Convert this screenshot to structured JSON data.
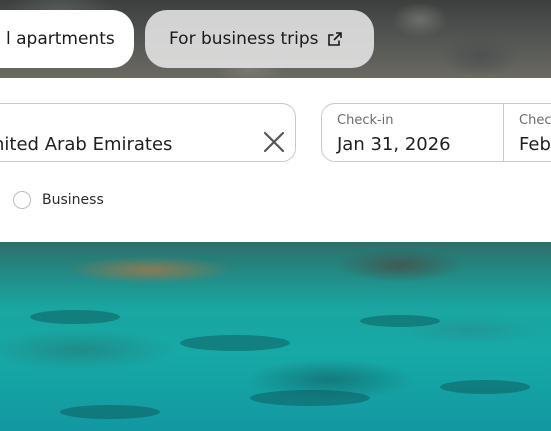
{
  "tabs": {
    "apartments_label": "l apartments",
    "business_label": "For business trips",
    "business_icon": "external-link-icon"
  },
  "search": {
    "destination_value": "nited Arab Emirates",
    "clear_icon": "close-icon",
    "checkin_label": "Check-in",
    "checkin_value": "Jan 31, 2026",
    "checkout_label": "Chec",
    "checkout_value": "Feb"
  },
  "trip_type": {
    "business_label": "Business"
  },
  "colors": {
    "panel": "#ffffff",
    "border": "#c9c9c9",
    "text": "#1f1f1f",
    "muted_text": "#6b6b6b",
    "water": "#17a9a6"
  }
}
